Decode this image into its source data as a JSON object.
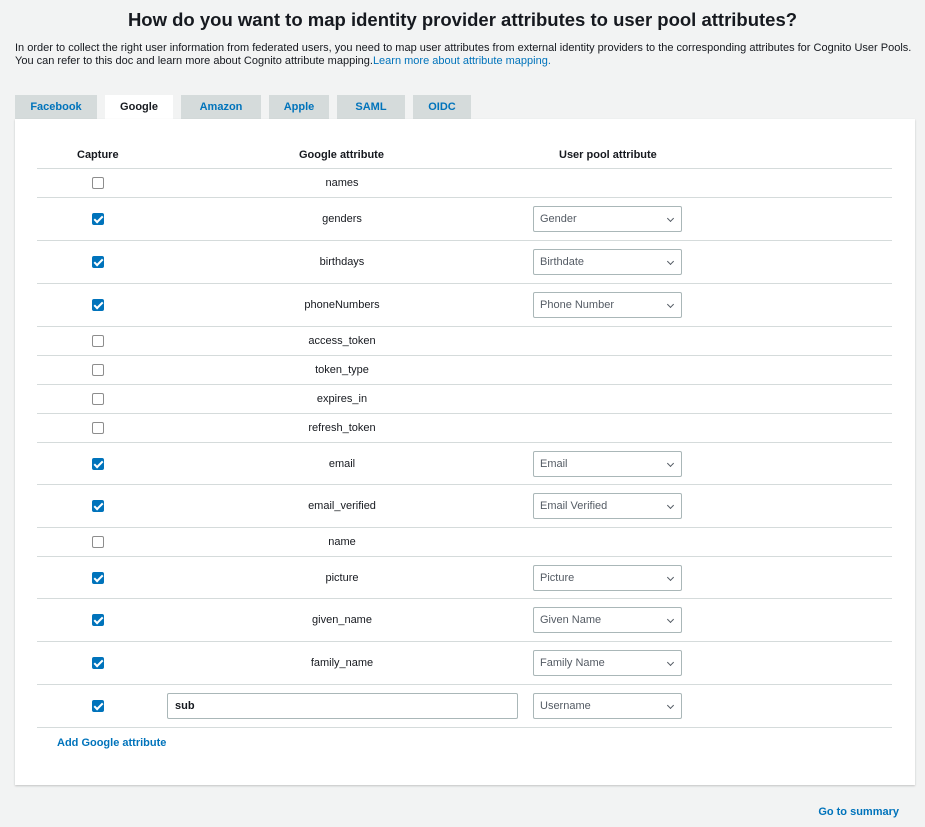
{
  "page": {
    "title": "How do you want to map identity provider attributes to user pool attributes?",
    "intro_text": "In order to collect the right user information from federated users, you need to map user attributes from external identity providers to the corresponding attributes for Cognito User Pools. You can refer to this doc and learn more about Cognito attribute mapping.",
    "intro_link": "Learn more about attribute mapping."
  },
  "tabs": [
    {
      "label": "Facebook",
      "active": false
    },
    {
      "label": "Google",
      "active": true
    },
    {
      "label": "Amazon",
      "active": false
    },
    {
      "label": "Apple",
      "active": false
    },
    {
      "label": "SAML",
      "active": false
    },
    {
      "label": "OIDC",
      "active": false
    }
  ],
  "table": {
    "headers": {
      "capture": "Capture",
      "provider_attribute": "Google attribute",
      "pool_attribute": "User pool attribute"
    },
    "rows": [
      {
        "attribute": "names",
        "checked": false,
        "mapped": ""
      },
      {
        "attribute": "genders",
        "checked": true,
        "mapped": "Gender"
      },
      {
        "attribute": "birthdays",
        "checked": true,
        "mapped": "Birthdate"
      },
      {
        "attribute": "phoneNumbers",
        "checked": true,
        "mapped": "Phone Number"
      },
      {
        "attribute": "access_token",
        "checked": false,
        "mapped": ""
      },
      {
        "attribute": "token_type",
        "checked": false,
        "mapped": ""
      },
      {
        "attribute": "expires_in",
        "checked": false,
        "mapped": ""
      },
      {
        "attribute": "refresh_token",
        "checked": false,
        "mapped": ""
      },
      {
        "attribute": "email",
        "checked": true,
        "mapped": "Email"
      },
      {
        "attribute": "email_verified",
        "checked": true,
        "mapped": "Email Verified"
      },
      {
        "attribute": "name",
        "checked": false,
        "mapped": ""
      },
      {
        "attribute": "picture",
        "checked": true,
        "mapped": "Picture"
      },
      {
        "attribute": "given_name",
        "checked": true,
        "mapped": "Given Name"
      },
      {
        "attribute": "family_name",
        "checked": true,
        "mapped": "Family Name"
      }
    ],
    "custom_row": {
      "value": "sub",
      "checked": true,
      "mapped": "Username"
    }
  },
  "actions": {
    "add_attribute": "Add Google attribute",
    "go_to_summary": "Go to summary"
  },
  "colors": {
    "link": "#0073bb",
    "checkbox": "#0073bb",
    "tab_inactive": "#d5dbdb"
  }
}
